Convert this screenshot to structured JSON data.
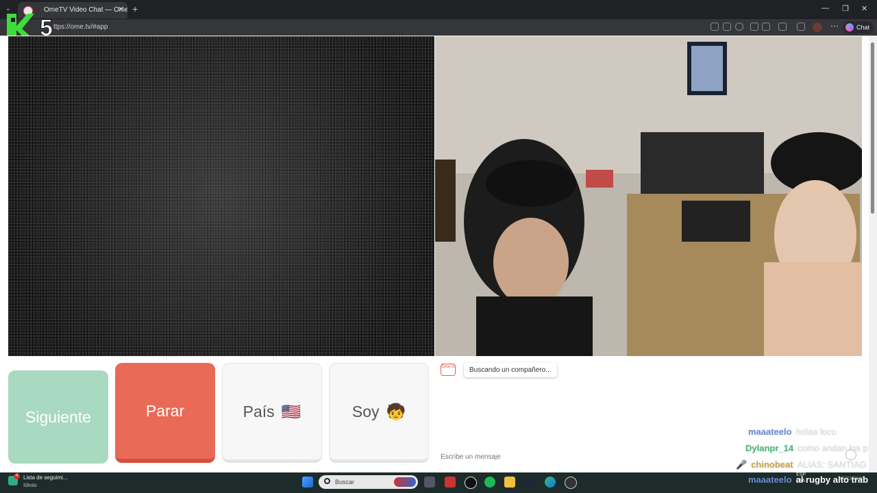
{
  "browser": {
    "tab_title": "OmeTV Video Chat — Omegl",
    "tab_close": "✕",
    "new_tab": "+",
    "url": "ttps://ome.tv/#app",
    "chat_button": "Chat",
    "menu_dots": "⋯",
    "window_controls": [
      "—",
      "❐",
      "✕"
    ]
  },
  "overlay_logo": {
    "letter": "K",
    "number": "5"
  },
  "buttons": {
    "next": "Siguiente",
    "stop": "Parar",
    "country": "País",
    "country_flag": "🇺🇸",
    "gender": "Soy",
    "gender_emoji": "🧒"
  },
  "chat": {
    "logo_text": "Ome tv",
    "status_message": "Buscando un compañero...",
    "input_placeholder": "Escribe un mensaje"
  },
  "stream_chat": [
    {
      "user": "maaateelo",
      "message": "holaa loco",
      "user_color": "#6a8fd6"
    },
    {
      "user": "Dylanpr_14",
      "message": "como andan los p",
      "user_color": "#4ab87a"
    },
    {
      "user": "chinobeat",
      "message": "ALIAS: SANTIAG",
      "user_color": "#c8a24a"
    },
    {
      "user": "maaateelo",
      "message": "al rugby alto trab",
      "user_color": "#6a8fd6"
    }
  ],
  "taskbar": {
    "widget_badge": "4",
    "widget_title": "Lista de seguimi...",
    "widget_subtitle": "Ideas",
    "search_label": "Buscar",
    "lang_top": "ESP",
    "lang_bottom": "LAA",
    "date": "09/02/2026"
  },
  "colors": {
    "next_button": "#a9d9c0",
    "stop_button": "#e96a56",
    "accent": "#e45a4b"
  }
}
